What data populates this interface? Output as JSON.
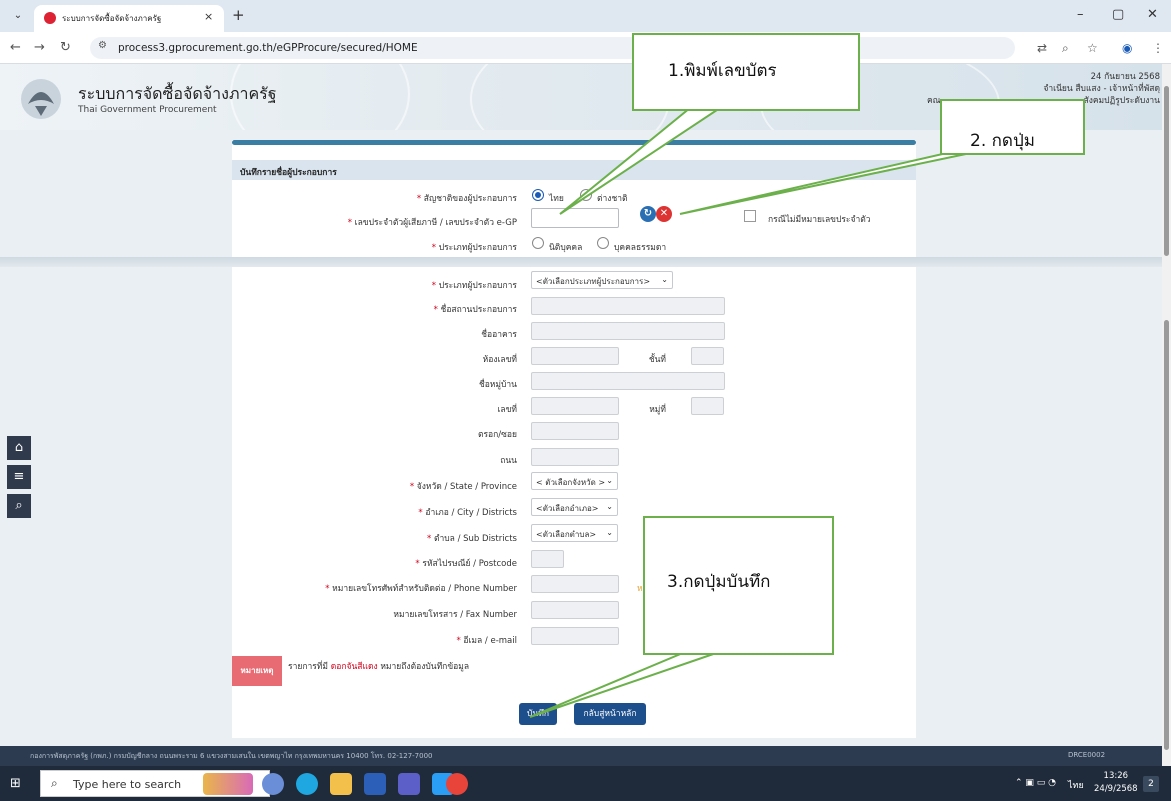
{
  "browser": {
    "tab_title": "ระบบการจัดซื้อจัดจ้างภาครัฐ",
    "url": "process3.gprocurement.go.th/eGPProcure/secured/HOME"
  },
  "site": {
    "title": "ระบบการจัดซื้อจัดจ้างภาครัฐ",
    "subtitle": "Thai Government Procurement",
    "date": "24 กันยายน 2568",
    "user": "จำเนียน สืบแสง - เจ้าหน้าที่พัสดุ",
    "org": "สังคมปฏิรูประดับงาน",
    "org_prefix": "คณ"
  },
  "form": {
    "header": "บันทึกรายชื่อผู้ประกอบการ",
    "nationality_label": "สัญชาติของผู้ประกอบการ",
    "nationality_options": [
      "ไทย",
      "ต่างชาติ"
    ],
    "taxid_label": "เลขประจำตัวผู้เสียภาษี / เลขประจำตัว e-GP",
    "no_taxid_label": "กรณีไม่มีหมายเลขประจำตัว",
    "type_label_top": "ประเภทผู้ประกอบการ",
    "type_options": [
      "นิติบุคคล",
      "บุคคลธรรมดา"
    ],
    "type_label": "ประเภทผู้ประกอบการ",
    "type_select": "<ตัวเลือกประเภทผู้ประกอบการ>",
    "business_name": "ชื่อสถานประกอบการ",
    "building": "ชื่ออาคาร",
    "room": "ห้องเลขที่",
    "floor": "ชั้นที่",
    "village": "ชื่อหมู่บ้าน",
    "house_no": "เลขที่",
    "moo": "หมู่ที่",
    "soi": "ตรอก/ซอย",
    "road": "ถนน",
    "province_label": "จังหวัด / State / Province",
    "province_select": "< ตัวเลือกจังหวัด >",
    "district_label": "อำเภอ / City / Districts",
    "district_select": "<ตัวเลือกอำเภอ>",
    "subdistrict_label": "ตำบล / Sub Districts",
    "subdistrict_select": "<ตัวเลือกตำบล>",
    "postcode_label": "รหัสไปรษณีย์ / Postcode",
    "phone_label": "หมายเลขโทรศัพท์สำหรับติดต่อ / Phone Number",
    "fax_label": "หมายเลขโทรสาร / Fax Number",
    "email_label": "อีเมล / e-mail",
    "note_tag": "หมายเหตุ",
    "note_prefix": "รายการที่มี",
    "note_red": "ดอกจันสีแดง",
    "note_suffix": "หมายถึงต้องบันทึกข้อมูล",
    "save_button": "บันทึก",
    "back_button": "กลับสู่หน้าหลัก",
    "phone_hint": "ห"
  },
  "callouts": {
    "step1": "1.พิมพ์เลขบัตร",
    "step2": "2. กดปุ่ม",
    "step3": "3.กดปุ่มบันทึก"
  },
  "footer": {
    "text": "กองการพัสดุภาครัฐ (กพภ.) กรมบัญชีกลาง ถนนพระราม 6 แขวงสามเสนใน เขตพญาไท กรุงเทพมหานคร 10400 โทร. 02-127-7000",
    "code": "DRCE0002"
  },
  "taskbar": {
    "search_placeholder": "Type here to search",
    "lang": "ไทย",
    "time": "13:26",
    "date": "24/9/2568",
    "notif_count": "2"
  }
}
